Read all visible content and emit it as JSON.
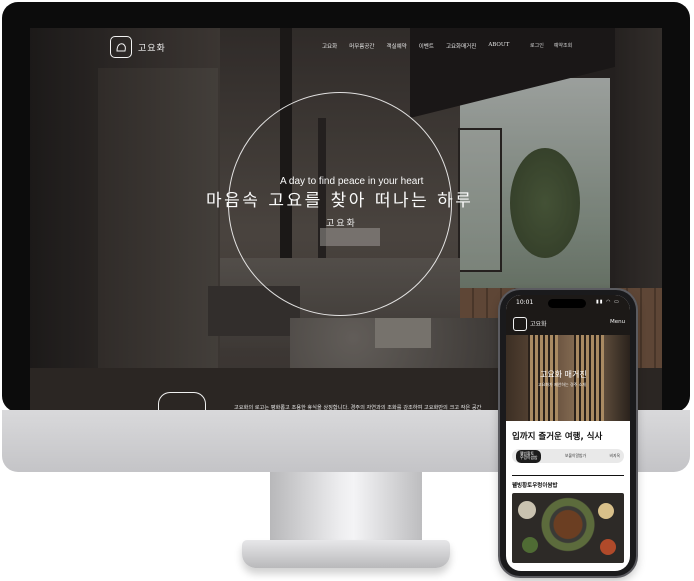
{
  "site": {
    "brand": "고요화",
    "nav": [
      "고요화",
      "머무름공간",
      "객실예약",
      "이벤트",
      "고요화매거진",
      "ABOUT"
    ],
    "nav_right": [
      "로그인",
      "예약조회"
    ],
    "hero": {
      "tagline_en": "A day to find peace in your heart",
      "title_ko": "마음속 고요를 찾아 떠나는 하루",
      "subtitle_ko": "고요화"
    },
    "about_text": "고요화의 로고는 평화롭고 조용한 휴식을 상징합니다. 경주의 자연과의 조화를 강조하여 고요화만의 크고 작은 공간"
  },
  "phone": {
    "time": "10:01",
    "status": "▮▮ ◠ ▭",
    "brand": "고요화",
    "menu_label": "Menu",
    "hero_title": "고요화 매거진",
    "hero_sub": "고요화가 제안하는 경주 소개",
    "heading": "입까지 즐거운 여행, 식사",
    "tabs": [
      "웰빙황토\n우렁이쌈밥",
      "보물이알밥가",
      "비지옥"
    ],
    "item_title": "웰빙황토우렁이쌈밥"
  },
  "icons": [
    "logo-icon",
    "camera-island"
  ],
  "colors": {
    "bezel": "#0c0c0c",
    "accent_dark": "#1c1c1c",
    "chin": "#d0d0d2"
  }
}
